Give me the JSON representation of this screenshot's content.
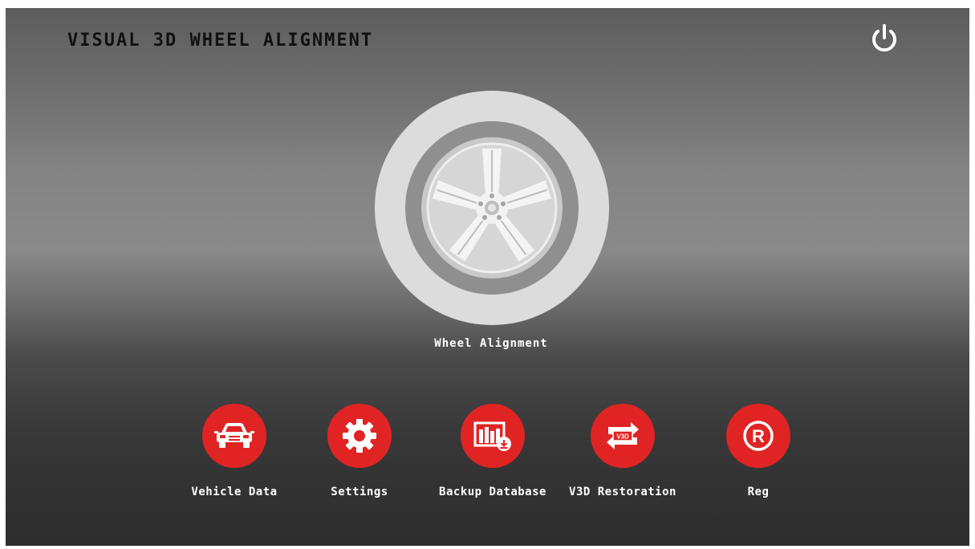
{
  "header": {
    "title": "VISUAL 3D WHEEL ALIGNMENT",
    "power_icon": "power-icon"
  },
  "main": {
    "wheel_label": "Wheel Alignment",
    "wheel_icon": "wheel-icon"
  },
  "tools": [
    {
      "label": "Vehicle Data",
      "icon": "car-icon"
    },
    {
      "label": "Settings",
      "icon": "gear-icon"
    },
    {
      "label": "Backup Database",
      "icon": "database-backup-icon"
    },
    {
      "label": "V3D Restoration",
      "icon": "restore-icon",
      "icon_text": "V3D"
    },
    {
      "label": "Reg",
      "icon": "registered-icon",
      "icon_text": "R"
    }
  ],
  "colors": {
    "accent": "#e02424",
    "tire": "#dcdcdc",
    "rim_inner": "#8f8f8f"
  }
}
